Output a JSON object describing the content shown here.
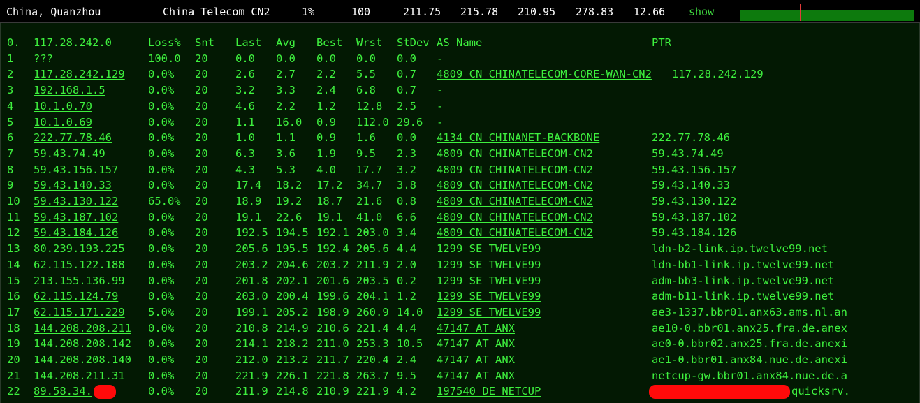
{
  "summary": {
    "location": "China, Quanzhou",
    "isp": "China Telecom CN2",
    "loss": "1%",
    "sent": "100",
    "last": "211.75",
    "avg": "215.78",
    "best": "210.95",
    "worst": "278.83",
    "stdev": "12.66",
    "show_label": "show"
  },
  "colors": {
    "terminal_bg": "#031903",
    "text_green": "#3ef03e",
    "bar_green": "#0d7a0d",
    "marker_red": "#e23b3b",
    "redaction_red": "#ff0a0a"
  },
  "header": {
    "hop": "0.",
    "host": "117.28.242.0",
    "loss": "Loss%",
    "snt": "Snt",
    "last": "Last",
    "avg": "Avg",
    "best": "Best",
    "wrst": "Wrst",
    "stdev": "StDev",
    "as": "AS Name",
    "ptr": "PTR"
  },
  "rows": [
    {
      "hop": "1",
      "host": "???",
      "loss": "100.0",
      "snt": "20",
      "last": "0.0",
      "avg": "0.0",
      "best": "0.0",
      "wrst": "0.0",
      "stdev": "0.0",
      "as": "-",
      "ptr": ""
    },
    {
      "hop": "2",
      "host": "117.28.242.129",
      "loss": "0.0%",
      "snt": "20",
      "last": "2.6",
      "avg": "2.7",
      "best": "2.2",
      "wrst": "5.5",
      "stdev": "0.7",
      "as": "4809  CN CHINATELECOM-CORE-WAN-CN2",
      "ptr": "117.28.242.129"
    },
    {
      "hop": "3",
      "host": "192.168.1.5",
      "loss": "0.0%",
      "snt": "20",
      "last": "3.2",
      "avg": "3.3",
      "best": "2.4",
      "wrst": "6.8",
      "stdev": "0.7",
      "as": "-",
      "ptr": ""
    },
    {
      "hop": "4",
      "host": "10.1.0.70",
      "loss": "0.0%",
      "snt": "20",
      "last": "4.6",
      "avg": "2.2",
      "best": "1.2",
      "wrst": "12.8",
      "stdev": "2.5",
      "as": "-",
      "ptr": ""
    },
    {
      "hop": "5",
      "host": "10.1.0.69",
      "loss": "0.0%",
      "snt": "20",
      "last": "1.1",
      "avg": "16.0",
      "best": "0.9",
      "wrst": "112.0",
      "stdev": "29.6",
      "as": "-",
      "ptr": ""
    },
    {
      "hop": "6",
      "host": "222.77.78.46",
      "loss": "0.0%",
      "snt": "20",
      "last": "1.0",
      "avg": "1.1",
      "best": "0.9",
      "wrst": "1.6",
      "stdev": "0.0",
      "as": "4134  CN CHINANET-BACKBONE",
      "ptr": "222.77.78.46"
    },
    {
      "hop": "7",
      "host": "59.43.74.49",
      "loss": "0.0%",
      "snt": "20",
      "last": "6.3",
      "avg": "3.6",
      "best": "1.9",
      "wrst": "9.5",
      "stdev": "2.3",
      "as": "4809  CN CHINATELECOM-CN2",
      "ptr": "59.43.74.49"
    },
    {
      "hop": "8",
      "host": "59.43.156.157",
      "loss": "0.0%",
      "snt": "20",
      "last": "4.3",
      "avg": "5.3",
      "best": "4.0",
      "wrst": "17.7",
      "stdev": "3.2",
      "as": "4809  CN CHINATELECOM-CN2",
      "ptr": "59.43.156.157"
    },
    {
      "hop": "9",
      "host": "59.43.140.33",
      "loss": "0.0%",
      "snt": "20",
      "last": "17.4",
      "avg": "18.2",
      "best": "17.2",
      "wrst": "34.7",
      "stdev": "3.8",
      "as": "4809  CN CHINATELECOM-CN2",
      "ptr": "59.43.140.33"
    },
    {
      "hop": "10",
      "host": "59.43.130.122",
      "loss": "65.0%",
      "snt": "20",
      "last": "18.9",
      "avg": "19.2",
      "best": "18.7",
      "wrst": "21.6",
      "stdev": "0.8",
      "as": "4809  CN CHINATELECOM-CN2",
      "ptr": "59.43.130.122"
    },
    {
      "hop": "11",
      "host": "59.43.187.102",
      "loss": "0.0%",
      "snt": "20",
      "last": "19.1",
      "avg": "22.6",
      "best": "19.1",
      "wrst": "41.0",
      "stdev": "6.6",
      "as": "4809  CN CHINATELECOM-CN2",
      "ptr": "59.43.187.102"
    },
    {
      "hop": "12",
      "host": "59.43.184.126",
      "loss": "0.0%",
      "snt": "20",
      "last": "192.5",
      "avg": "194.5",
      "best": "192.1",
      "wrst": "203.0",
      "stdev": "3.4",
      "as": "4809  CN CHINATELECOM-CN2",
      "ptr": "59.43.184.126"
    },
    {
      "hop": "13",
      "host": "80.239.193.225",
      "loss": "0.0%",
      "snt": "20",
      "last": "205.6",
      "avg": "195.5",
      "best": "192.4",
      "wrst": "205.6",
      "stdev": "4.4",
      "as": "1299  SE TWELVE99",
      "ptr": "ldn-b2-link.ip.twelve99.net"
    },
    {
      "hop": "14",
      "host": "62.115.122.188",
      "loss": "0.0%",
      "snt": "20",
      "last": "203.2",
      "avg": "204.6",
      "best": "203.2",
      "wrst": "211.9",
      "stdev": "2.0",
      "as": "1299  SE TWELVE99",
      "ptr": "ldn-bb1-link.ip.twelve99.net"
    },
    {
      "hop": "15",
      "host": "213.155.136.99",
      "loss": "0.0%",
      "snt": "20",
      "last": "201.8",
      "avg": "202.1",
      "best": "201.6",
      "wrst": "203.5",
      "stdev": "0.2",
      "as": "1299  SE TWELVE99",
      "ptr": "adm-bb3-link.ip.twelve99.net"
    },
    {
      "hop": "16",
      "host": "62.115.124.79",
      "loss": "0.0%",
      "snt": "20",
      "last": "203.0",
      "avg": "200.4",
      "best": "199.6",
      "wrst": "204.1",
      "stdev": "1.2",
      "as": "1299  SE TWELVE99",
      "ptr": "adm-b11-link.ip.twelve99.net"
    },
    {
      "hop": "17",
      "host": "62.115.171.229",
      "loss": "5.0%",
      "snt": "20",
      "last": "199.1",
      "avg": "205.2",
      "best": "198.9",
      "wrst": "260.9",
      "stdev": "14.0",
      "as": "1299  SE TWELVE99",
      "ptr": "ae3-1337.bbr01.anx63.ams.nl.an"
    },
    {
      "hop": "18",
      "host": "144.208.208.211",
      "loss": "0.0%",
      "snt": "20",
      "last": "210.8",
      "avg": "214.9",
      "best": "210.6",
      "wrst": "221.4",
      "stdev": "4.4",
      "as": "47147 AT ANX",
      "ptr": "ae10-0.bbr01.anx25.fra.de.anex"
    },
    {
      "hop": "19",
      "host": "144.208.208.142",
      "loss": "0.0%",
      "snt": "20",
      "last": "214.1",
      "avg": "218.2",
      "best": "211.0",
      "wrst": "253.3",
      "stdev": "10.5",
      "as": "47147 AT ANX",
      "ptr": "ae0-0.bbr02.anx25.fra.de.anexi"
    },
    {
      "hop": "20",
      "host": "144.208.208.140",
      "loss": "0.0%",
      "snt": "20",
      "last": "212.0",
      "avg": "213.2",
      "best": "211.7",
      "wrst": "220.4",
      "stdev": "2.4",
      "as": "47147 AT ANX",
      "ptr": "ae1-0.bbr01.anx84.nue.de.anexi"
    },
    {
      "hop": "21",
      "host": "144.208.211.31",
      "loss": "0.0%",
      "snt": "20",
      "last": "221.9",
      "avg": "226.1",
      "best": "221.8",
      "wrst": "263.7",
      "stdev": "9.5",
      "as": "47147 AT ANX",
      "ptr": "netcup-gw.bbr01.anx84.nue.de.a"
    },
    {
      "hop": "22",
      "host": "89.58.34.",
      "loss": "0.0%",
      "snt": "20",
      "last": "211.9",
      "avg": "214.8",
      "best": "210.9",
      "wrst": "221.9",
      "stdev": "4.2",
      "as": "197540 DE NETCUP",
      "ptr": "quicksrv."
    }
  ]
}
